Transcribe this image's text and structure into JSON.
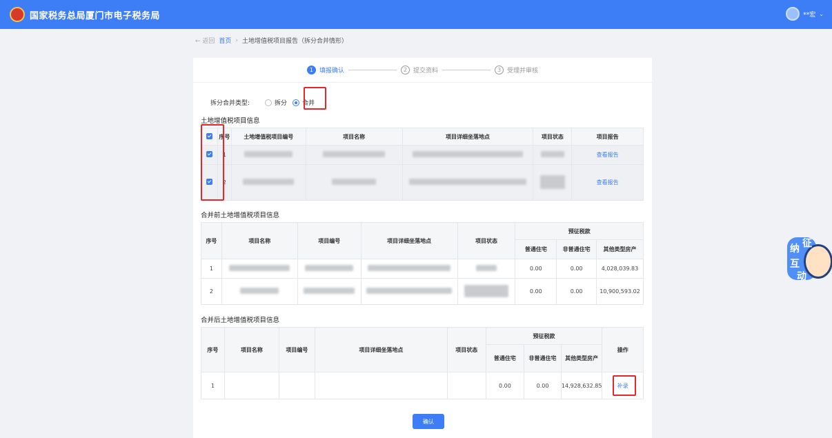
{
  "header": {
    "title": "国家税务总局厦门市电子税务局",
    "user": "**宏"
  },
  "breadcrumb": {
    "back": "← 返回",
    "home": "首页",
    "sep": "›",
    "current": "土地增值税项目报告（拆分合并情形）"
  },
  "steps": [
    {
      "num": "1",
      "label": "填报确认"
    },
    {
      "num": "2",
      "label": "提交资料"
    },
    {
      "num": "3",
      "label": "受理并审核"
    }
  ],
  "type_row": {
    "label": "拆分合并类型:",
    "option_split": "拆分",
    "option_merge": "合并",
    "selected": "合并"
  },
  "table1": {
    "title": "土地增值税项目信息",
    "headers": [
      "序号",
      "土地增值税项目编号",
      "项目名称",
      "项目详细坐落地点",
      "项目状态",
      "项目报告"
    ],
    "rows": [
      {
        "no": "1",
        "report": "查看报告"
      },
      {
        "no": "2",
        "report": "查看报告"
      }
    ]
  },
  "table2": {
    "title": "合并前土地增值税项目信息",
    "headers": [
      "序号",
      "项目名称",
      "项目编号",
      "项目详细坐落地点",
      "项目状态",
      "预征税款",
      "普通住宅",
      "非普通住宅",
      "其他类型房产"
    ],
    "rows": [
      {
        "no": "1",
        "ord": "0.00",
        "non": "0.00",
        "other": "4,028,039.83"
      },
      {
        "no": "2",
        "ord": "0.00",
        "non": "0.00",
        "other": "10,900,593.02"
      }
    ]
  },
  "table3": {
    "title": "合并后土地增值税项目信息",
    "headers": [
      "序号",
      "项目名称",
      "项目编号",
      "项目详细坐落地点",
      "项目状态",
      "预征税款",
      "普通住宅",
      "非普通住宅",
      "其他类型房产",
      "操作"
    ],
    "rows": [
      {
        "no": "1",
        "ord": "0.00",
        "non": "0.00",
        "other": "14,928,632.85",
        "action": "补录"
      }
    ]
  },
  "confirm_label": "确认",
  "mascot_chars": [
    "纳",
    "征",
    "互",
    "动"
  ],
  "colors": {
    "brand": "#3d7df5",
    "highlight": "#e8262a"
  }
}
